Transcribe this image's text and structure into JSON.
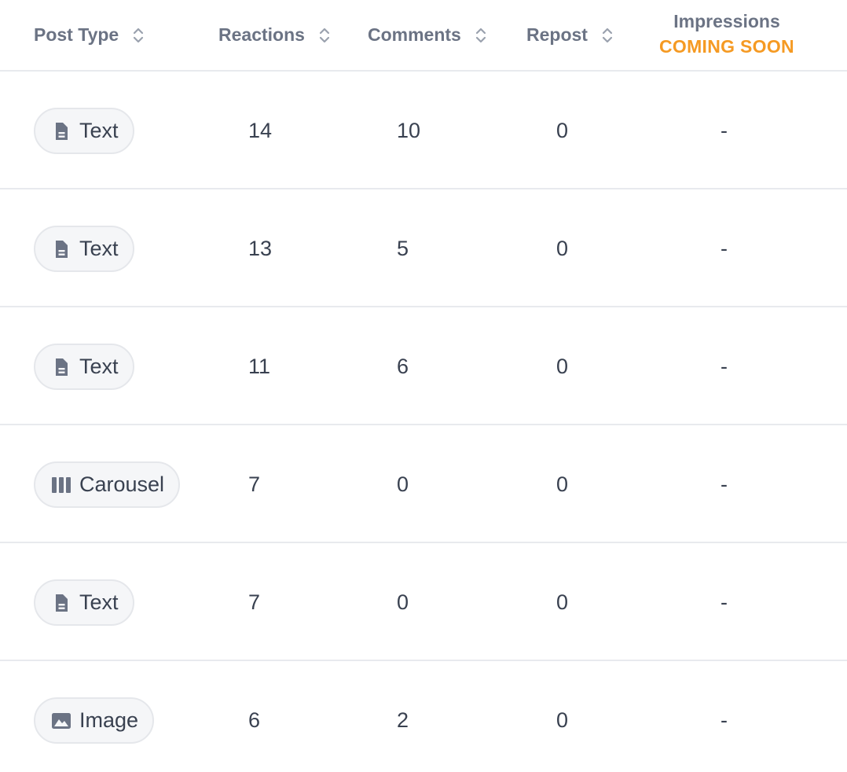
{
  "columns": {
    "post_type": "Post Type",
    "reactions": "Reactions",
    "comments": "Comments",
    "repost": "Repost",
    "impressions": "Impressions",
    "impressions_badge": "COMING SOON"
  },
  "colors": {
    "header_text": "#6b7384",
    "cell_text": "#394150",
    "badge": "#f59a23",
    "divider": "#e8eaee",
    "pill_bg": "#f5f6f8"
  },
  "rows": [
    {
      "type": "Text",
      "icon": "document-icon",
      "reactions": "14",
      "comments": "10",
      "repost": "0",
      "impressions": "-"
    },
    {
      "type": "Text",
      "icon": "document-icon",
      "reactions": "13",
      "comments": "5",
      "repost": "0",
      "impressions": "-"
    },
    {
      "type": "Text",
      "icon": "document-icon",
      "reactions": "11",
      "comments": "6",
      "repost": "0",
      "impressions": "-"
    },
    {
      "type": "Carousel",
      "icon": "carousel-icon",
      "reactions": "7",
      "comments": "0",
      "repost": "0",
      "impressions": "-"
    },
    {
      "type": "Text",
      "icon": "document-icon",
      "reactions": "7",
      "comments": "0",
      "repost": "0",
      "impressions": "-"
    },
    {
      "type": "Image",
      "icon": "image-icon",
      "reactions": "6",
      "comments": "2",
      "repost": "0",
      "impressions": "-"
    }
  ]
}
